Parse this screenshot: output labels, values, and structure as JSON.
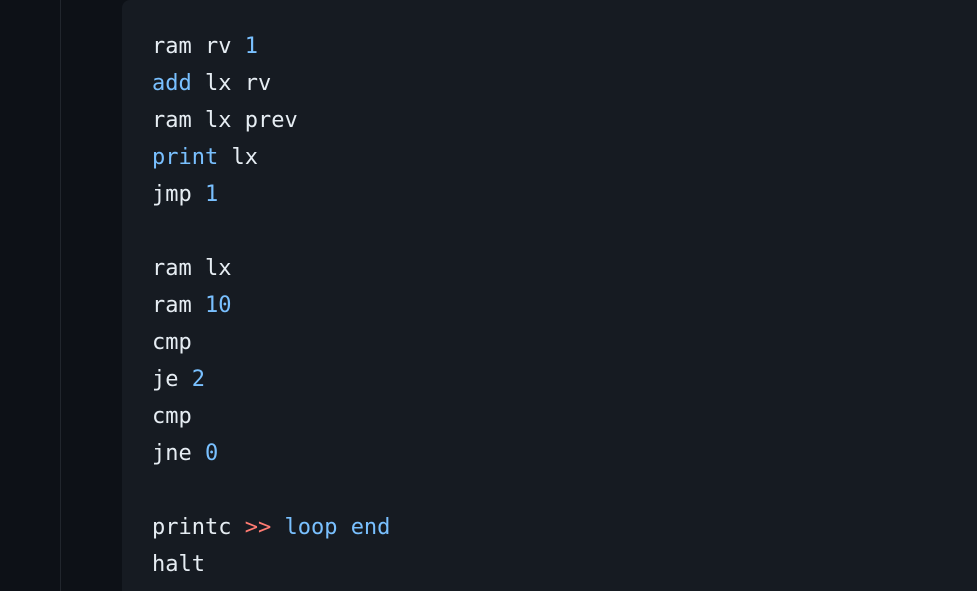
{
  "code_block": {
    "lines": [
      [
        {
          "t": "ram rv ",
          "k": "plain"
        },
        {
          "t": "1",
          "k": "num"
        }
      ],
      [
        {
          "t": "add",
          "k": "kw"
        },
        {
          "t": " lx rv",
          "k": "plain"
        }
      ],
      [
        {
          "t": "ram lx prev",
          "k": "plain"
        }
      ],
      [
        {
          "t": "print",
          "k": "kw"
        },
        {
          "t": " lx",
          "k": "plain"
        }
      ],
      [
        {
          "t": "jmp ",
          "k": "plain"
        },
        {
          "t": "1",
          "k": "num"
        }
      ],
      [],
      [
        {
          "t": "ram lx",
          "k": "plain"
        }
      ],
      [
        {
          "t": "ram ",
          "k": "plain"
        },
        {
          "t": "10",
          "k": "num"
        }
      ],
      [
        {
          "t": "cmp",
          "k": "plain"
        }
      ],
      [
        {
          "t": "je ",
          "k": "plain"
        },
        {
          "t": "2",
          "k": "num"
        }
      ],
      [
        {
          "t": "cmp",
          "k": "plain"
        }
      ],
      [
        {
          "t": "jne ",
          "k": "plain"
        },
        {
          "t": "0",
          "k": "num"
        }
      ],
      [],
      [
        {
          "t": "printc ",
          "k": "plain"
        },
        {
          "t": ">>",
          "k": "op"
        },
        {
          "t": " loop end",
          "k": "str"
        }
      ],
      [
        {
          "t": "halt",
          "k": "plain"
        }
      ]
    ]
  },
  "colors": {
    "page_background": "#0d1117",
    "code_background": "#161b22",
    "text": "#e6edf3",
    "number_keyword": "#79c0ff",
    "operator": "#ff7b72"
  }
}
